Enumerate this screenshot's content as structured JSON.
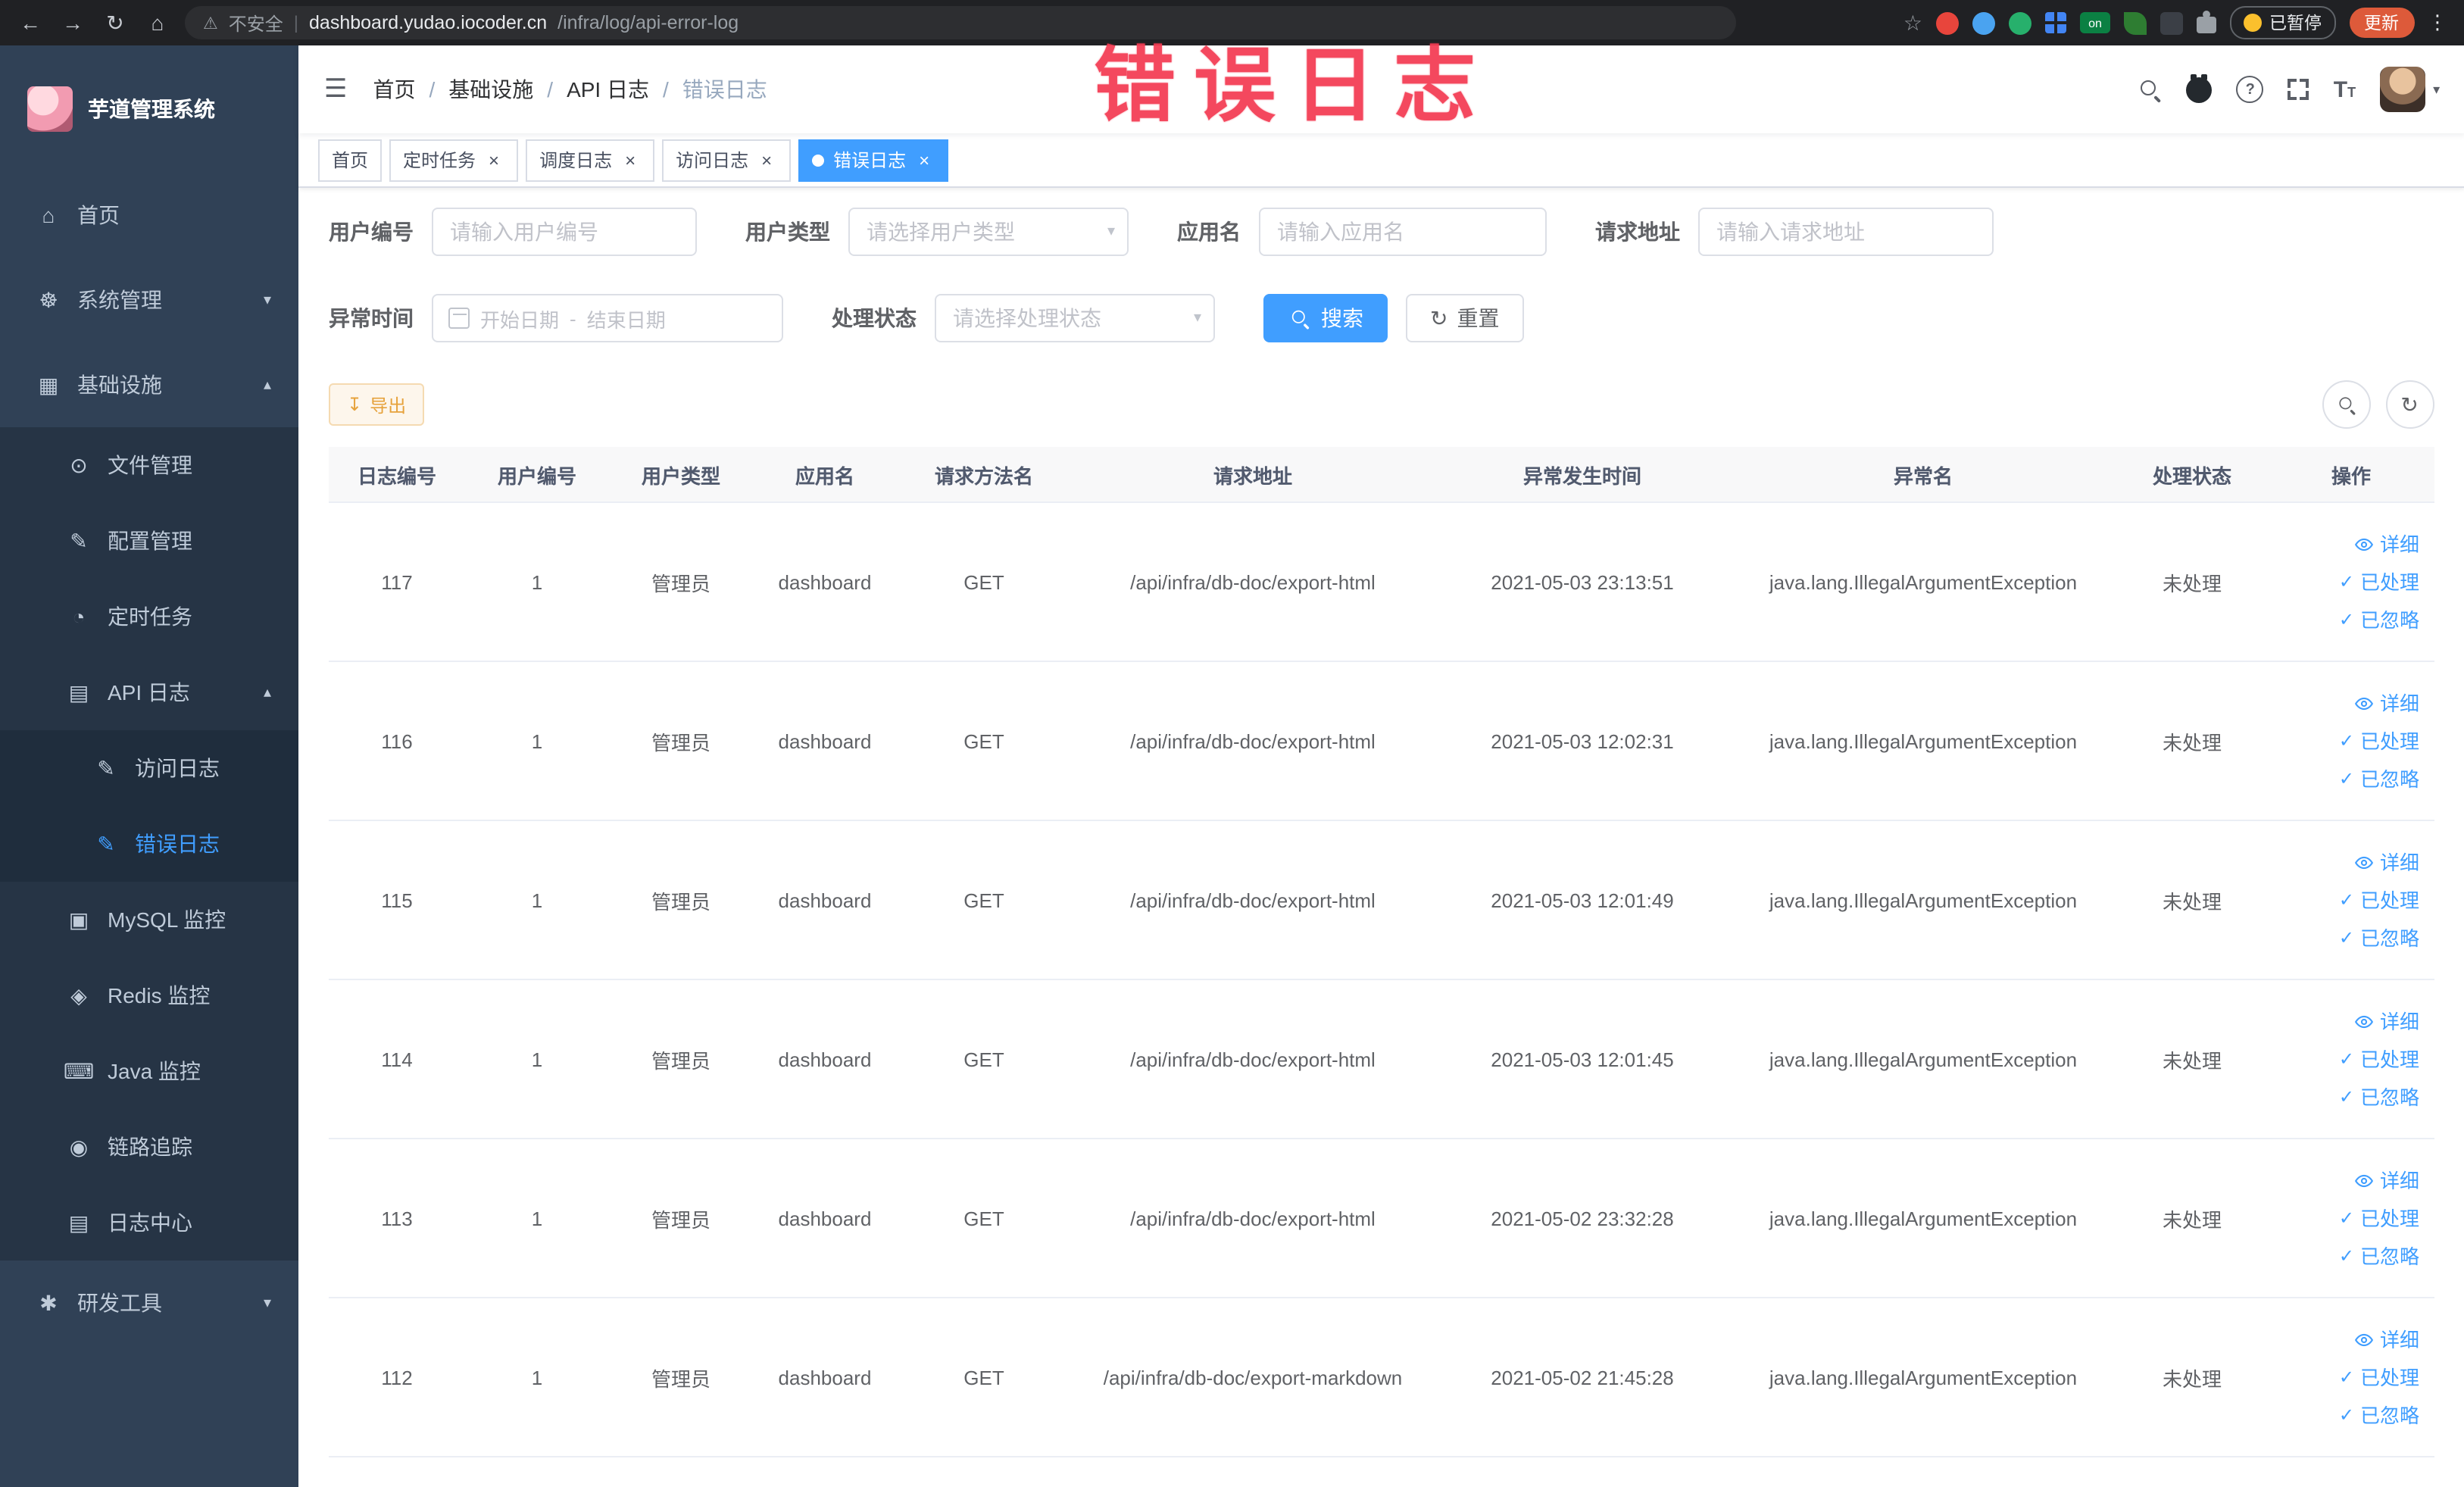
{
  "browser": {
    "security_label": "不安全",
    "url_host": "dashboard.yudao.iocoder.cn",
    "url_path": "/infra/log/api-error-log",
    "paused_badge": "已暂停",
    "update_button": "更新",
    "ext_badge_on": "on"
  },
  "sidebar": {
    "logo_title": "芋道管理系统",
    "home": "首页",
    "system": "系统管理",
    "infra": "基础设施",
    "devtools": "研发工具",
    "infra_children": [
      "文件管理",
      "配置管理",
      "定时任务",
      "API 日志",
      "MySQL 监控",
      "Redis 监控",
      "Java 监控",
      "链路追踪",
      "日志中心"
    ],
    "api_children": [
      "访问日志",
      "错误日志"
    ]
  },
  "header": {
    "breadcrumb": [
      "首页",
      "基础设施",
      "API 日志",
      "错误日志"
    ]
  },
  "tabs": [
    "首页",
    "定时任务",
    "调度日志",
    "访问日志",
    "错误日志"
  ],
  "watermark": "错误日志",
  "filters": {
    "user_id_label": "用户编号",
    "user_id_placeholder": "请输入用户编号",
    "user_type_label": "用户类型",
    "user_type_placeholder": "请选择用户类型",
    "app_name_label": "应用名",
    "app_name_placeholder": "请输入应用名",
    "request_url_label": "请求地址",
    "request_url_placeholder": "请输入请求地址",
    "time_label": "异常时间",
    "start_placeholder": "开始日期",
    "range_separator": "-",
    "end_placeholder": "结束日期",
    "status_label": "处理状态",
    "status_placeholder": "请选择处理状态",
    "search_button": "搜索",
    "reset_button": "重置"
  },
  "toolbar": {
    "export_button": "导出"
  },
  "table": {
    "columns": [
      "日志编号",
      "用户编号",
      "用户类型",
      "应用名",
      "请求方法名",
      "请求地址",
      "异常发生时间",
      "异常名",
      "处理状态",
      "操作"
    ],
    "actions": {
      "detail": "详细",
      "processed": "已处理",
      "ignored": "已忽略"
    },
    "rows": [
      {
        "id": "117",
        "user_id": "1",
        "user_type": "管理员",
        "app": "dashboard",
        "method": "GET",
        "url": "/api/infra/db-doc/export-html",
        "time": "2021-05-03 23:13:51",
        "exception": "java.lang.IllegalArgumentException",
        "status": "未处理"
      },
      {
        "id": "116",
        "user_id": "1",
        "user_type": "管理员",
        "app": "dashboard",
        "method": "GET",
        "url": "/api/infra/db-doc/export-html",
        "time": "2021-05-03 12:02:31",
        "exception": "java.lang.IllegalArgumentException",
        "status": "未处理"
      },
      {
        "id": "115",
        "user_id": "1",
        "user_type": "管理员",
        "app": "dashboard",
        "method": "GET",
        "url": "/api/infra/db-doc/export-html",
        "time": "2021-05-03 12:01:49",
        "exception": "java.lang.IllegalArgumentException",
        "status": "未处理"
      },
      {
        "id": "114",
        "user_id": "1",
        "user_type": "管理员",
        "app": "dashboard",
        "method": "GET",
        "url": "/api/infra/db-doc/export-html",
        "time": "2021-05-03 12:01:45",
        "exception": "java.lang.IllegalArgumentException",
        "status": "未处理"
      },
      {
        "id": "113",
        "user_id": "1",
        "user_type": "管理员",
        "app": "dashboard",
        "method": "GET",
        "url": "/api/infra/db-doc/export-html",
        "time": "2021-05-02 23:32:28",
        "exception": "java.lang.IllegalArgumentException",
        "status": "未处理"
      },
      {
        "id": "112",
        "user_id": "1",
        "user_type": "管理员",
        "app": "dashboard",
        "method": "GET",
        "url": "/api/infra/db-doc/export-markdown",
        "time": "2021-05-02 21:45:28",
        "exception": "java.lang.IllegalArgumentException",
        "status": "未处理"
      }
    ]
  },
  "colors": {
    "accent": "#409eff",
    "sidebar_bg": "#304156",
    "watermark_red": "#f43b52",
    "warning": "#e6a23c",
    "update_pill": "#dd5a3a"
  }
}
